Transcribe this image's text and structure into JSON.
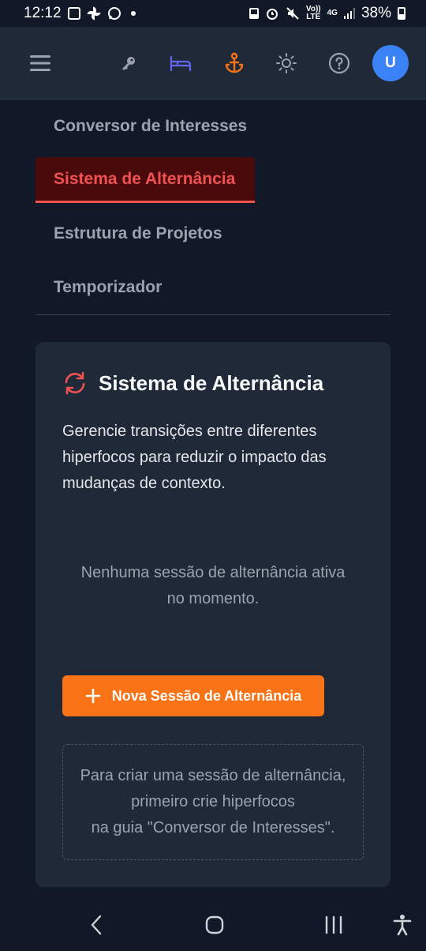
{
  "status_bar": {
    "time": "12:12",
    "battery": "38%",
    "volte_top": "Vo))",
    "volte_bottom": "LTE",
    "network": "4G"
  },
  "nav": {
    "items": [
      {
        "label": "Conversor de Interesses",
        "active": false
      },
      {
        "label": "Sistema de Alternância",
        "active": true
      },
      {
        "label": "Estrutura de Projetos",
        "active": false
      },
      {
        "label": "Temporizador",
        "active": false
      }
    ]
  },
  "header": {
    "avatar_initial": "U",
    "icons": [
      "menu-icon",
      "key-icon",
      "bed-icon",
      "anchor-icon",
      "sun-icon",
      "help-icon"
    ],
    "colors": {
      "bed": "#6366f1",
      "anchor": "#f97316",
      "avatar": "#3b82f6"
    }
  },
  "card": {
    "title": "Sistema de Alternância",
    "description": "Gerencie transições entre diferentes hiperfocos para reduzir o impacto das mudanças de contexto.",
    "empty_line1": "Nenhuma sessão de alternância ativa",
    "empty_line2": "no momento.",
    "new_button": "Nova Sessão de Alternância",
    "hint_line1": "Para criar uma sessão de alternância,",
    "hint_line2": "primeiro crie hiperfocos",
    "hint_line3": "na guia \"Conversor de Interesses\"."
  },
  "colors": {
    "active_tab": "#f05252",
    "accent_button": "#f97316",
    "background": "#111827",
    "card": "#1f2937"
  }
}
